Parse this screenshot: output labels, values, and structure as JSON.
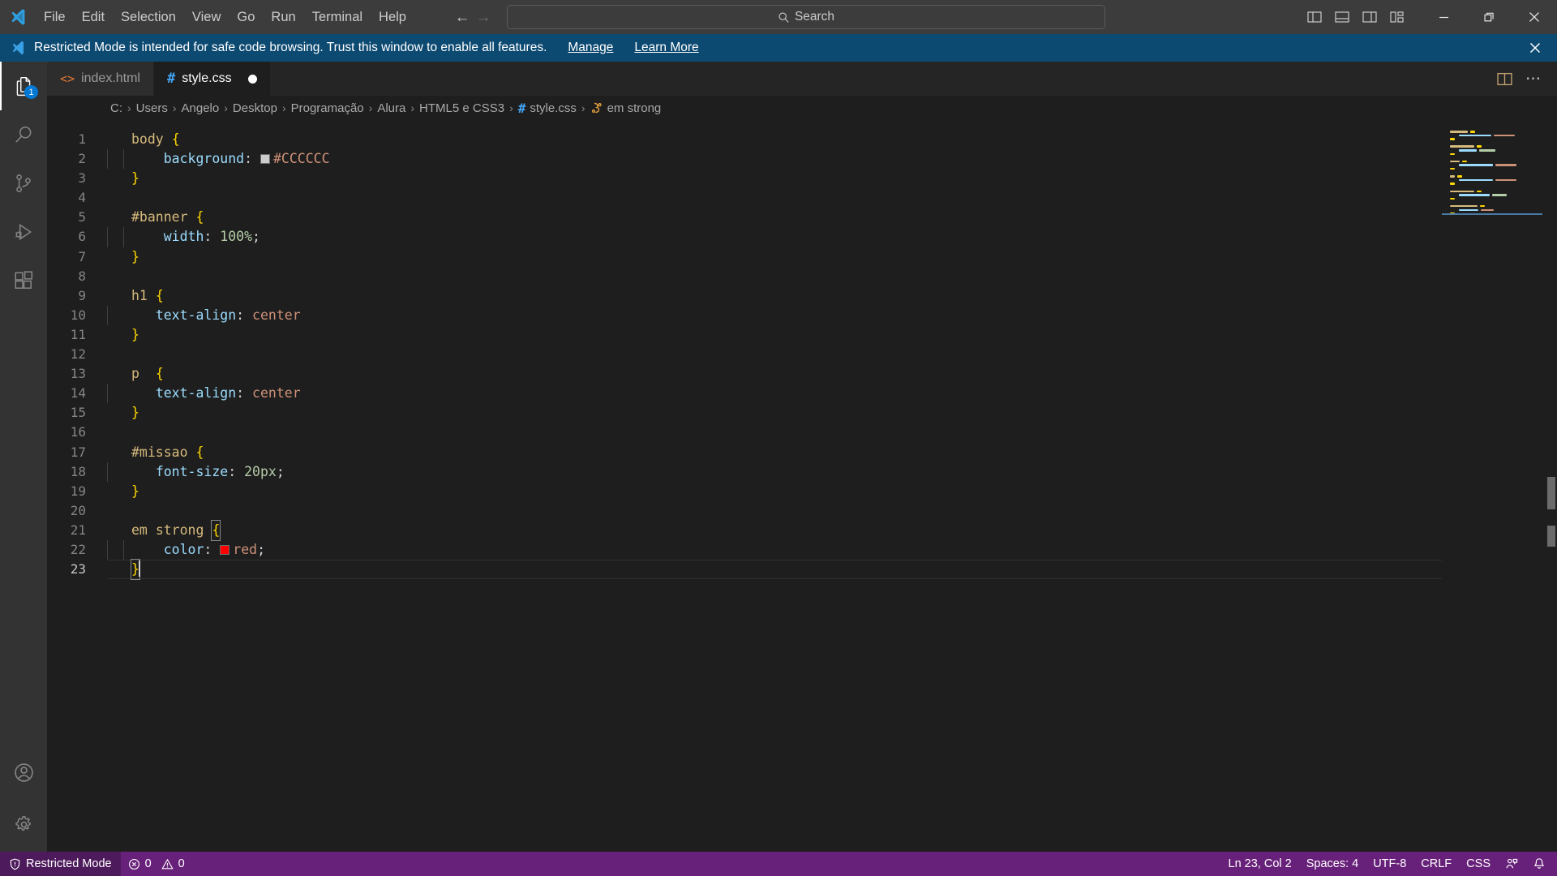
{
  "titlebar": {
    "logo_icon": "vscode-logo-icon",
    "menus": [
      "File",
      "Edit",
      "Selection",
      "View",
      "Go",
      "Run",
      "Terminal",
      "Help"
    ],
    "nav_back_icon": "arrow-left-icon",
    "nav_forward_icon": "arrow-right-icon",
    "search": {
      "placeholder": "Search",
      "value": "",
      "icon": "search-icon"
    },
    "layout_buttons": [
      {
        "name": "toggle-primary-sidebar",
        "icon": "layout-sidebar-left-icon"
      },
      {
        "name": "toggle-panel",
        "icon": "layout-panel-icon"
      },
      {
        "name": "toggle-secondary-sidebar",
        "icon": "layout-sidebar-right-icon"
      },
      {
        "name": "customize-layout",
        "icon": "layout-customize-icon"
      }
    ],
    "window_controls": [
      {
        "name": "minimize-button",
        "icon": "minimize-icon",
        "glyph": "—"
      },
      {
        "name": "maximize-button",
        "icon": "restore-icon",
        "glyph": "❐"
      },
      {
        "name": "close-button",
        "icon": "close-icon",
        "glyph": "✕"
      }
    ]
  },
  "banner": {
    "icon": "vscode-shield-logo-icon",
    "text": "Restricted Mode is intended for safe code browsing. Trust this window to enable all features.",
    "manage_label": "Manage",
    "learn_more_label": "Learn More",
    "close_icon": "close-icon",
    "background": "#0d4a72"
  },
  "activitybar": {
    "items": [
      {
        "name": "sidebar-item-explorer",
        "icon": "files-explorer-icon",
        "active": true,
        "badge": "1"
      },
      {
        "name": "sidebar-item-search",
        "icon": "search-icon",
        "active": false,
        "badge": ""
      },
      {
        "name": "sidebar-item-source-control",
        "icon": "source-control-branch-icon",
        "active": false,
        "badge": ""
      },
      {
        "name": "sidebar-item-run-debug",
        "icon": "run-and-debug-icon",
        "active": false,
        "badge": ""
      },
      {
        "name": "sidebar-item-extensions",
        "icon": "extensions-icon",
        "active": false,
        "badge": ""
      }
    ],
    "bottom_items": [
      {
        "name": "accounts-button",
        "icon": "account-person-icon"
      },
      {
        "name": "manage-settings-button",
        "icon": "gear-icon"
      }
    ]
  },
  "tabs": [
    {
      "label": "index.html",
      "icon": "html-file-icon",
      "icon_glyph": "<>",
      "icon_color": "#e37933",
      "active": false,
      "dirty": false
    },
    {
      "label": "style.css",
      "icon": "css-file-icon",
      "icon_glyph": "#",
      "icon_color": "#42a5f5",
      "active": true,
      "dirty": true
    }
  ],
  "editor_actions": [
    {
      "name": "split-editor-right-button",
      "icon": "split-editor-icon"
    },
    {
      "name": "more-actions-button",
      "icon": "ellipsis-icon",
      "glyph": "⋯"
    }
  ],
  "breadcrumbs": {
    "separator": "›",
    "items": [
      {
        "label": "C:",
        "icon": ""
      },
      {
        "label": "Users",
        "icon": ""
      },
      {
        "label": "Angelo",
        "icon": ""
      },
      {
        "label": "Desktop",
        "icon": ""
      },
      {
        "label": "Programação",
        "icon": ""
      },
      {
        "label": "Alura",
        "icon": ""
      },
      {
        "label": "HTML5 e CSS3",
        "icon": ""
      },
      {
        "label": "style.css",
        "icon": "css-file-icon"
      },
      {
        "label": "em strong",
        "icon": "css-selector-symbol-icon"
      }
    ]
  },
  "editor": {
    "language": "css",
    "file_name": "style.css",
    "total_lines": 23,
    "cursor_line": 23,
    "lines": [
      {
        "n": 1,
        "tokens": [
          {
            "t": "body",
            "c": "sel"
          },
          {
            "t": " ",
            "c": "punc"
          },
          {
            "t": "{",
            "c": "brace"
          }
        ]
      },
      {
        "n": 2,
        "tokens": [
          {
            "t": "    ",
            "c": "punc"
          },
          {
            "t": "background",
            "c": "prop"
          },
          {
            "t": ": ",
            "c": "colon"
          },
          {
            "t": "#CCCCCC",
            "c": "val",
            "swatch": "#cccccc"
          }
        ]
      },
      {
        "n": 3,
        "tokens": [
          {
            "t": "}",
            "c": "brace"
          }
        ]
      },
      {
        "n": 4,
        "tokens": []
      },
      {
        "n": 5,
        "tokens": [
          {
            "t": "#banner",
            "c": "sel"
          },
          {
            "t": " ",
            "c": "punc"
          },
          {
            "t": "{",
            "c": "brace"
          }
        ]
      },
      {
        "n": 6,
        "tokens": [
          {
            "t": "    ",
            "c": "punc"
          },
          {
            "t": "width",
            "c": "prop"
          },
          {
            "t": ": ",
            "c": "colon"
          },
          {
            "t": "100%",
            "c": "num"
          },
          {
            "t": ";",
            "c": "punc"
          }
        ]
      },
      {
        "n": 7,
        "tokens": [
          {
            "t": "}",
            "c": "brace"
          }
        ]
      },
      {
        "n": 8,
        "tokens": []
      },
      {
        "n": 9,
        "tokens": [
          {
            "t": "h1",
            "c": "sel"
          },
          {
            "t": " ",
            "c": "punc"
          },
          {
            "t": "{",
            "c": "brace"
          }
        ]
      },
      {
        "n": 10,
        "tokens": [
          {
            "t": "   ",
            "c": "punc"
          },
          {
            "t": "text-align",
            "c": "prop"
          },
          {
            "t": ": ",
            "c": "colon"
          },
          {
            "t": "center",
            "c": "val"
          }
        ]
      },
      {
        "n": 11,
        "tokens": [
          {
            "t": "}",
            "c": "brace"
          }
        ]
      },
      {
        "n": 12,
        "tokens": []
      },
      {
        "n": 13,
        "tokens": [
          {
            "t": "p",
            "c": "sel"
          },
          {
            "t": "  ",
            "c": "punc"
          },
          {
            "t": "{",
            "c": "brace"
          }
        ]
      },
      {
        "n": 14,
        "tokens": [
          {
            "t": "   ",
            "c": "punc"
          },
          {
            "t": "text-align",
            "c": "prop"
          },
          {
            "t": ": ",
            "c": "colon"
          },
          {
            "t": "center",
            "c": "val"
          }
        ]
      },
      {
        "n": 15,
        "tokens": [
          {
            "t": "}",
            "c": "brace"
          }
        ]
      },
      {
        "n": 16,
        "tokens": []
      },
      {
        "n": 17,
        "tokens": [
          {
            "t": "#missao",
            "c": "sel"
          },
          {
            "t": " ",
            "c": "punc"
          },
          {
            "t": "{",
            "c": "brace"
          }
        ]
      },
      {
        "n": 18,
        "tokens": [
          {
            "t": "   ",
            "c": "punc"
          },
          {
            "t": "font-size",
            "c": "prop"
          },
          {
            "t": ": ",
            "c": "colon"
          },
          {
            "t": "20px",
            "c": "num"
          },
          {
            "t": ";",
            "c": "punc"
          }
        ]
      },
      {
        "n": 19,
        "tokens": [
          {
            "t": "}",
            "c": "brace"
          }
        ]
      },
      {
        "n": 20,
        "tokens": []
      },
      {
        "n": 21,
        "tokens": [
          {
            "t": "em",
            "c": "sel"
          },
          {
            "t": " ",
            "c": "punc"
          },
          {
            "t": "strong",
            "c": "sel"
          },
          {
            "t": " ",
            "c": "punc"
          },
          {
            "t": "{",
            "c": "brace",
            "bracket_match": true
          }
        ]
      },
      {
        "n": 22,
        "tokens": [
          {
            "t": "    ",
            "c": "punc"
          },
          {
            "t": "color",
            "c": "prop"
          },
          {
            "t": ": ",
            "c": "colon"
          },
          {
            "t": "red",
            "c": "val",
            "swatch": "#ff0000"
          },
          {
            "t": ";",
            "c": "punc"
          }
        ]
      },
      {
        "n": 23,
        "tokens": [
          {
            "t": "}",
            "c": "brace",
            "bracket_match": true
          }
        ],
        "current": true,
        "caret_after": true
      }
    ]
  },
  "statusbar": {
    "background": "#68217a",
    "left": [
      {
        "name": "status-restricted-mode",
        "label": "Restricted Mode",
        "icon": "shield-warning-icon",
        "highlight": true
      },
      {
        "name": "status-problems",
        "label": "0",
        "label2": "0",
        "icon": "error-circle-icon",
        "icon2": "warning-triangle-icon"
      }
    ],
    "right": [
      {
        "name": "status-cursor-position",
        "label": "Ln 23, Col 2"
      },
      {
        "name": "status-indentation",
        "label": "Spaces: 4"
      },
      {
        "name": "status-encoding",
        "label": "UTF-8"
      },
      {
        "name": "status-eol",
        "label": "CRLF"
      },
      {
        "name": "status-language-mode",
        "label": "CSS"
      },
      {
        "name": "status-feedback",
        "label": "",
        "icon": "feedback-person-icon"
      },
      {
        "name": "status-notifications",
        "label": "",
        "icon": "bell-icon"
      }
    ]
  },
  "minimap": {
    "cursor_line": 23,
    "lines": [
      {
        "n": 1,
        "toks": [
          [
            22,
            "#d7ba7d"
          ],
          [
            6,
            "#ffd700"
          ]
        ]
      },
      {
        "n": 2,
        "toks": [
          [
            8,
            "#1e1e1e"
          ],
          [
            40,
            "#9cdcfe"
          ],
          [
            26,
            "#ce9178"
          ]
        ]
      },
      {
        "n": 3,
        "toks": [
          [
            6,
            "#ffd700"
          ]
        ]
      },
      {
        "n": 4,
        "toks": []
      },
      {
        "n": 5,
        "toks": [
          [
            30,
            "#d7ba7d"
          ],
          [
            6,
            "#ffd700"
          ]
        ]
      },
      {
        "n": 6,
        "toks": [
          [
            8,
            "#1e1e1e"
          ],
          [
            22,
            "#9cdcfe"
          ],
          [
            20,
            "#b5cea8"
          ]
        ]
      },
      {
        "n": 7,
        "toks": [
          [
            6,
            "#ffd700"
          ]
        ]
      },
      {
        "n": 8,
        "toks": []
      },
      {
        "n": 9,
        "toks": [
          [
            12,
            "#d7ba7d"
          ],
          [
            6,
            "#ffd700"
          ]
        ]
      },
      {
        "n": 10,
        "toks": [
          [
            8,
            "#1e1e1e"
          ],
          [
            42,
            "#9cdcfe"
          ],
          [
            26,
            "#ce9178"
          ]
        ]
      },
      {
        "n": 11,
        "toks": [
          [
            6,
            "#ffd700"
          ]
        ]
      },
      {
        "n": 12,
        "toks": []
      },
      {
        "n": 13,
        "toks": [
          [
            6,
            "#d7ba7d"
          ],
          [
            6,
            "#ffd700"
          ]
        ]
      },
      {
        "n": 14,
        "toks": [
          [
            8,
            "#1e1e1e"
          ],
          [
            42,
            "#9cdcfe"
          ],
          [
            26,
            "#ce9178"
          ]
        ]
      },
      {
        "n": 15,
        "toks": [
          [
            6,
            "#ffd700"
          ]
        ]
      },
      {
        "n": 16,
        "toks": []
      },
      {
        "n": 17,
        "toks": [
          [
            30,
            "#d7ba7d"
          ],
          [
            6,
            "#ffd700"
          ]
        ]
      },
      {
        "n": 18,
        "toks": [
          [
            8,
            "#1e1e1e"
          ],
          [
            38,
            "#9cdcfe"
          ],
          [
            18,
            "#b5cea8"
          ]
        ]
      },
      {
        "n": 19,
        "toks": [
          [
            6,
            "#ffd700"
          ]
        ]
      },
      {
        "n": 20,
        "toks": []
      },
      {
        "n": 21,
        "toks": [
          [
            34,
            "#d7ba7d"
          ],
          [
            6,
            "#ffd700"
          ]
        ]
      },
      {
        "n": 22,
        "toks": [
          [
            8,
            "#1e1e1e"
          ],
          [
            24,
            "#9cdcfe"
          ],
          [
            16,
            "#ce9178"
          ]
        ]
      },
      {
        "n": 23,
        "toks": [
          [
            6,
            "#ffd700"
          ]
        ]
      }
    ]
  }
}
